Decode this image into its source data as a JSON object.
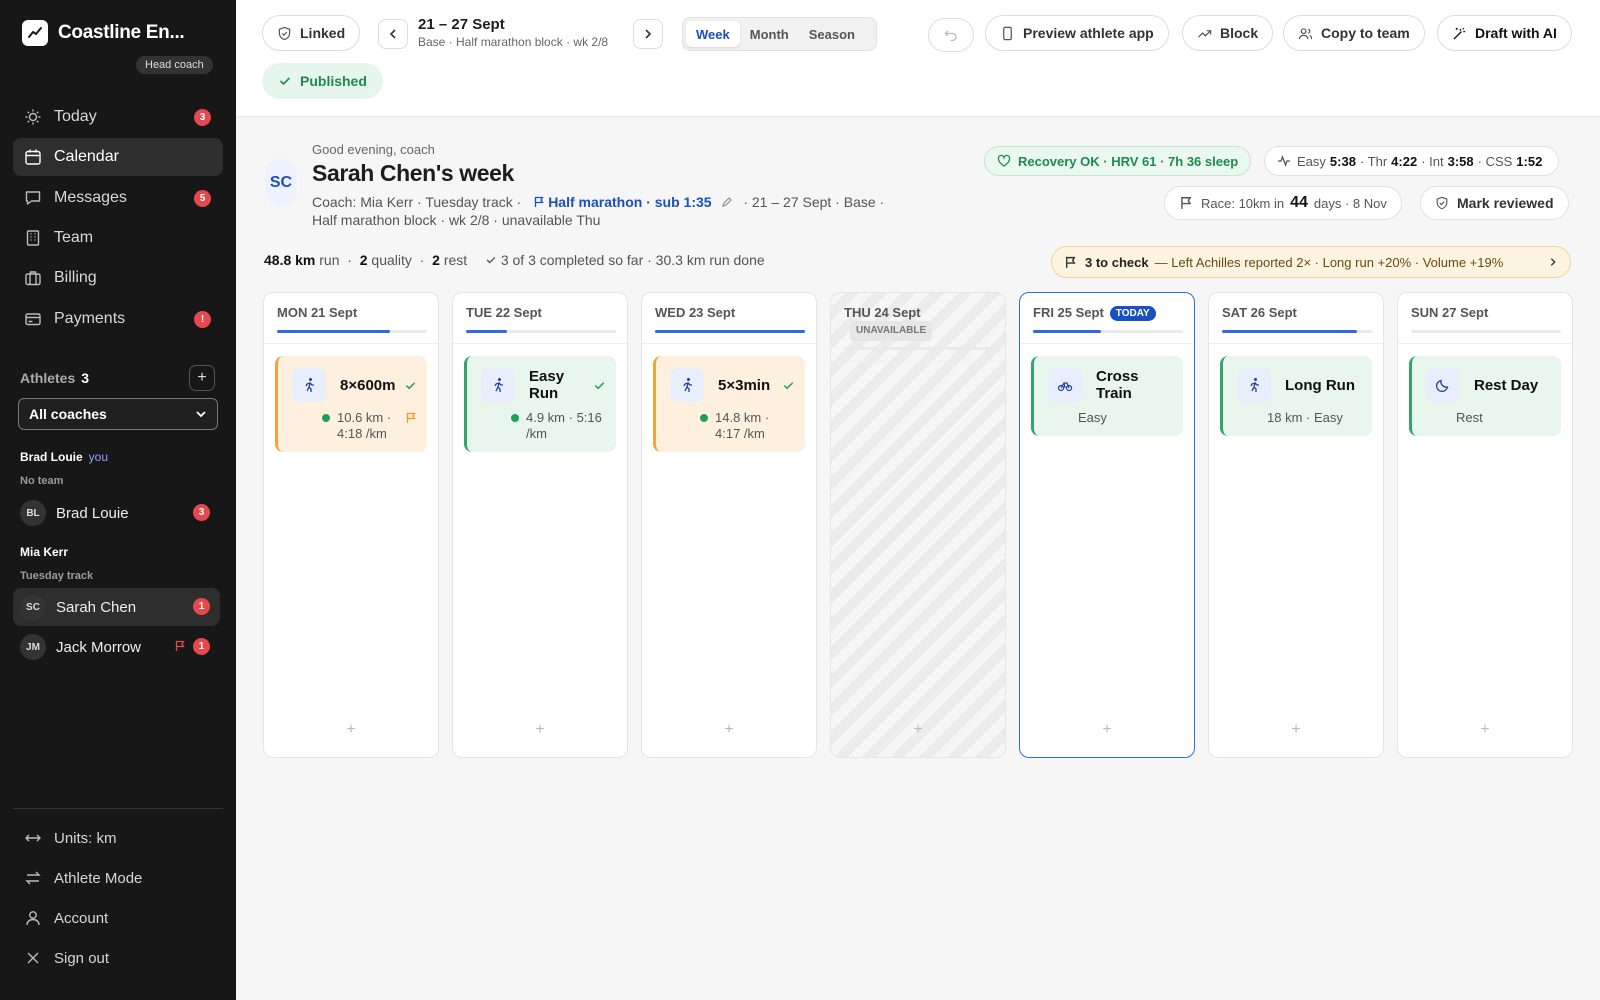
{
  "brand": {
    "name": "Coastline En...",
    "role": "Head coach"
  },
  "nav": [
    {
      "label": "Today",
      "badge": "3"
    },
    {
      "label": "Calendar",
      "badge": ""
    },
    {
      "label": "Messages",
      "badge": "5"
    },
    {
      "label": "Team",
      "badge": ""
    },
    {
      "label": "Billing",
      "badge": ""
    },
    {
      "label": "Payments",
      "badge": "!"
    }
  ],
  "athletes": {
    "label": "Athletes",
    "count": "3",
    "add": "+",
    "coach_filter": "All coaches",
    "groups": [
      {
        "coach": "Brad Louie",
        "you": "you",
        "team": "No team",
        "members": [
          {
            "initials": "BL",
            "name": "Brad Louie",
            "badge": "3"
          }
        ]
      },
      {
        "coach": "Mia Kerr",
        "team": "Tuesday track",
        "members": [
          {
            "initials": "SC",
            "name": "Sarah Chen",
            "badge": "1"
          },
          {
            "initials": "JM",
            "name": "Jack Morrow",
            "badge": "1"
          }
        ]
      }
    ]
  },
  "bottom_nav": [
    "Units: km",
    "Athlete Mode",
    "Account",
    "Sign out"
  ],
  "toolbar": {
    "linked": "Linked",
    "range_title": "21 – 27 Sept",
    "range_sub": "Base · Half marathon block · wk 2/8",
    "views": [
      "Week",
      "Month",
      "Season"
    ],
    "preview": "Preview athlete app",
    "block": "Block",
    "copy": "Copy to team",
    "draft": "Draft with AI",
    "published": "Published"
  },
  "header": {
    "initials": "SC",
    "greeting": "Good evening, coach",
    "title": "Sarah Chen's week",
    "meta_pre": "Coach: Mia Kerr · Tuesday track ·",
    "goal": "Half marathon · sub 1:35",
    "meta_post": "· 21 – 27 Sept · Base ·",
    "meta_line2": "Half marathon block · wk 2/8 · unavailable Thu",
    "recovery": "Recovery OK · HRV 61 · 7h 36 sleep",
    "paces": {
      "easy_l": "Easy",
      "easy": "5:38",
      "thr_l": "· Thr",
      "thr": "4:22",
      "int_l": "· Int",
      "int": "3:58",
      "css_l": "· CSS",
      "css": "1:52"
    },
    "race_pre": "Race: 10km in",
    "race_days": "44",
    "race_post": "days · 8 Nov",
    "review": "Mark reviewed"
  },
  "stats": {
    "km": "48.8 km",
    "km_l": "run",
    "q": "2",
    "q_l": "quality",
    "r": "2",
    "r_l": "rest",
    "done": "3 of 3 completed so far · 30.3 km run done"
  },
  "alerts": {
    "count": "3 to check",
    "text": "— Left Achilles reported 2× · Long run +20% · Volume +19%"
  },
  "days": [
    {
      "label": "MON 21 Sept",
      "progress": 0.75,
      "card": {
        "name": "8×600m",
        "detail": "10.6 km · 4:18 /km"
      }
    },
    {
      "label": "TUE 22 Sept",
      "progress": 0.27,
      "card": {
        "name": "Easy Run",
        "detail": "4.9 km · 5:16 /km"
      }
    },
    {
      "label": "WED 23 Sept",
      "progress": 1.0,
      "card": {
        "name": "5×3min",
        "detail": "14.8 km · 4:17 /km"
      }
    },
    {
      "label": "THU 24 Sept",
      "badge": "UNAVAILABLE",
      "progress": 0
    },
    {
      "label": "FRI 25 Sept",
      "badge": "TODAY",
      "progress": 0.45,
      "card": {
        "name": "Cross Train",
        "detail": "Easy"
      }
    },
    {
      "label": "SAT 26 Sept",
      "progress": 0.9,
      "card": {
        "name": "Long Run",
        "detail": "18 km · Easy"
      }
    },
    {
      "label": "SUN 27 Sept",
      "progress": 0,
      "card": {
        "name": "Rest Day",
        "detail": "Rest"
      }
    }
  ],
  "add_symbol": "+"
}
